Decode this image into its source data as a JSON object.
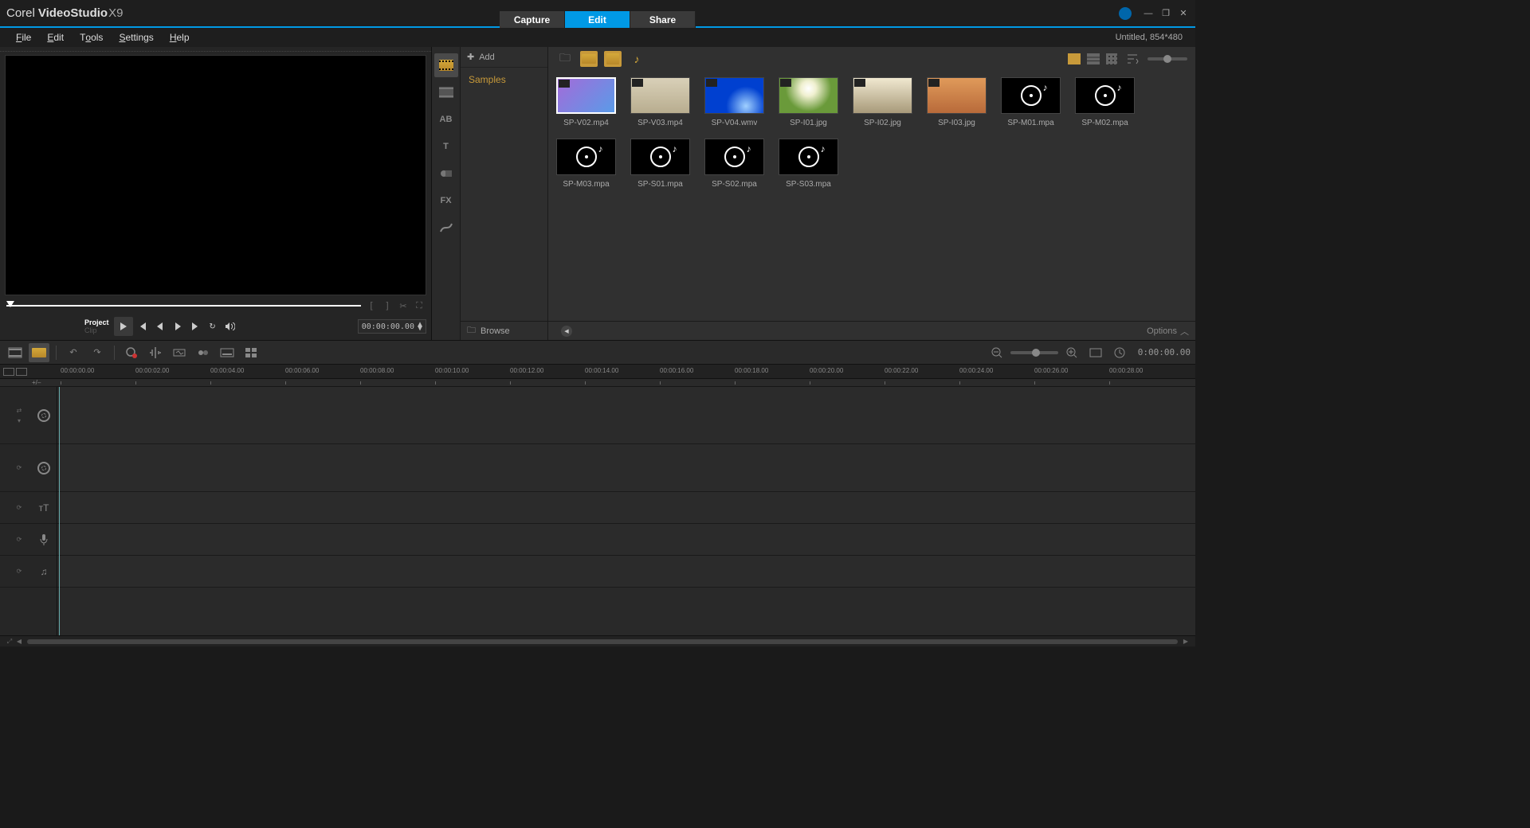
{
  "brand": {
    "corel": "Corel",
    "name": "VideoStudio",
    "version": "X9"
  },
  "modes": {
    "capture": "Capture",
    "edit": "Edit",
    "share": "Share",
    "active": "edit"
  },
  "menu": {
    "file": "File",
    "edit": "Edit",
    "tools": "Tools",
    "settings": "Settings",
    "help": "Help"
  },
  "project_info": "Untitled, 854*480",
  "preview": {
    "mode_label": "Project",
    "mode_sub": "Clip",
    "timecode": "00:00:00.00"
  },
  "library": {
    "add_label": "Add",
    "samples_label": "Samples",
    "browse_label": "Browse",
    "options_label": "Options",
    "items": [
      {
        "label": "SP-V02.mp4",
        "type": "video",
        "thumb": "v02",
        "selected": true
      },
      {
        "label": "SP-V03.mp4",
        "type": "video",
        "thumb": "v03"
      },
      {
        "label": "SP-V04.wmv",
        "type": "video",
        "thumb": "v04"
      },
      {
        "label": "SP-I01.jpg",
        "type": "image",
        "thumb": "i01"
      },
      {
        "label": "SP-I02.jpg",
        "type": "image",
        "thumb": "i02"
      },
      {
        "label": "SP-I03.jpg",
        "type": "image",
        "thumb": "i03"
      },
      {
        "label": "SP-M01.mpa",
        "type": "audio"
      },
      {
        "label": "SP-M02.mpa",
        "type": "audio"
      },
      {
        "label": "SP-M03.mpa",
        "type": "audio"
      },
      {
        "label": "SP-S01.mpa",
        "type": "audio"
      },
      {
        "label": "SP-S02.mpa",
        "type": "audio"
      },
      {
        "label": "SP-S03.mpa",
        "type": "audio"
      }
    ]
  },
  "timeline": {
    "timecode": "0:00:00.00",
    "ruler": [
      "00:00:00.00",
      "00:00:02.00",
      "00:00:04.00",
      "00:00:06.00",
      "00:00:08.00",
      "00:00:10.00",
      "00:00:12.00",
      "00:00:14.00",
      "00:00:16.00",
      "00:00:18.00",
      "00:00:20.00",
      "00:00:22.00",
      "00:00:24.00",
      "00:00:26.00",
      "00:00:28.00"
    ],
    "guide_marker": "+/–"
  }
}
